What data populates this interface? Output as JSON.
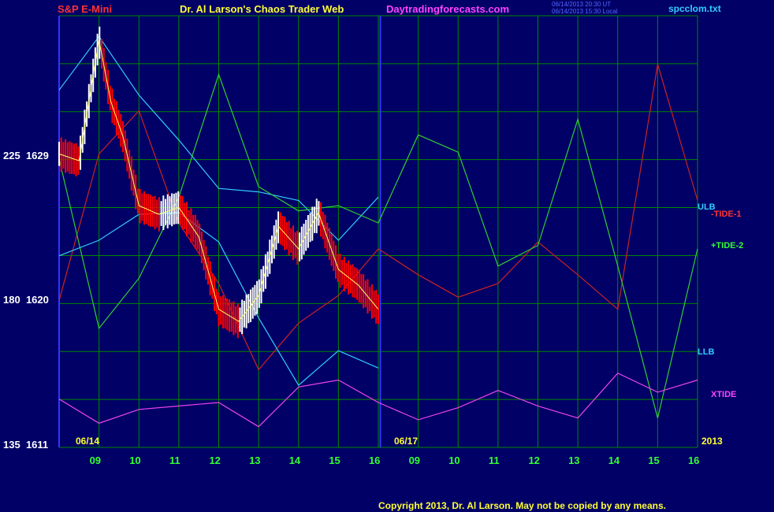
{
  "header": {
    "symbol": "S&P E-Mini",
    "title": "Dr. Al Larson's Chaos Trader Web",
    "site": "Daytradingforecasts.com",
    "timestamp_ut": "06/14/2013 20:30 UT",
    "timestamp_local": "06/14/2013 15:30 Local",
    "file": "spcclom.txt"
  },
  "colors": {
    "background": "#000066",
    "grid": "#008800",
    "price_up": "#ffffff",
    "price_down": "#ff0000",
    "bands": "#33ccff",
    "tide1": "#cc2222",
    "tide2": "#33cc33",
    "xtide": "#ee44ee",
    "divider": "#3333ff"
  },
  "chart_data": {
    "type": "line",
    "title": "S&P E-Mini",
    "y_tick_labels": [
      {
        "left": "225",
        "right": "1629"
      },
      {
        "left": "180",
        "right": "1620"
      },
      {
        "left": "135",
        "right": "1611"
      }
    ],
    "x_tick_labels": [
      "09",
      "10",
      "11",
      "12",
      "13",
      "14",
      "15",
      "16",
      "09",
      "10",
      "11",
      "12",
      "13",
      "14",
      "15",
      "16"
    ],
    "date_labels": [
      "06/14",
      "06/17",
      "2013"
    ],
    "series": [
      {
        "name": "ULB",
        "color": "#33ccff",
        "x": [
          0,
          1,
          2,
          3,
          4,
          5,
          6,
          7,
          8
        ],
        "y": [
          1631.7,
          1634.8,
          1631.4,
          1628.8,
          1626.0,
          1625.8,
          1625.3,
          1623.0,
          1625.5
        ]
      },
      {
        "name": "-TIDE-1",
        "color": "#cc2222",
        "x": [
          0,
          1,
          2,
          3,
          4,
          5,
          6,
          7,
          8,
          9,
          10,
          11,
          12,
          13,
          14,
          15,
          16
        ],
        "y": [
          1619.5,
          1628.0,
          1630.5,
          1624.0,
          1620.5,
          1615.5,
          1618.2,
          1619.8,
          1622.5,
          1621.0,
          1619.7,
          1620.5,
          1622.9,
          1621.0,
          1619.0,
          1633.2,
          1625.3
        ]
      },
      {
        "name": "+TIDE-2",
        "color": "#33cc33",
        "x": [
          0,
          1,
          2,
          3,
          4,
          5,
          6,
          7,
          8,
          9,
          10,
          11,
          12,
          13,
          14,
          15,
          16
        ],
        "y": [
          1627.7,
          1617.9,
          1620.8,
          1625.5,
          1632.6,
          1626.1,
          1624.7,
          1625.0,
          1624.0,
          1629.1,
          1628.1,
          1621.5,
          1622.7,
          1630.0,
          1621.5,
          1612.7,
          1622.5
        ]
      },
      {
        "name": "LLB",
        "color": "#33ccff",
        "x": [
          0,
          1,
          2,
          3,
          4,
          5,
          6,
          7,
          8
        ],
        "y": [
          1622.1,
          1623.0,
          1624.5,
          1624.6,
          1622.9,
          1618.5,
          1614.6,
          1616.6,
          1615.6
        ]
      },
      {
        "name": "XTIDE",
        "color": "#ee44ee",
        "x": [
          0,
          1,
          2,
          3,
          4,
          5,
          6,
          7,
          8,
          9,
          10,
          11,
          12,
          13,
          14,
          15,
          16
        ],
        "y": [
          1613.8,
          1612.4,
          1613.2,
          1613.4,
          1613.6,
          1612.2,
          1614.5,
          1614.9,
          1613.6,
          1612.6,
          1613.3,
          1614.3,
          1613.4,
          1612.7,
          1615.3,
          1614.2,
          1614.9
        ]
      }
    ],
    "price": {
      "x": [
        0,
        0.5,
        1,
        1.3,
        1.6,
        2,
        2.5,
        3,
        3.5,
        4,
        4.5,
        5,
        5.5,
        6,
        6.5,
        7,
        7.5,
        8
      ],
      "y": [
        1628.0,
        1627.6,
        1634.6,
        1631.0,
        1629.0,
        1625.0,
        1624.5,
        1624.9,
        1623.2,
        1619.0,
        1618.3,
        1619.8,
        1623.8,
        1622.5,
        1624.6,
        1621.3,
        1620.4,
        1619.0
      ]
    }
  },
  "series_labels": {
    "ulb": "ULB",
    "tide1": "-TIDE-1",
    "tide2": "+TIDE-2",
    "llb": "LLB",
    "xtide": "XTIDE"
  },
  "copyright": "Copyright 2013, Dr. Al Larson. May not be copied by any means."
}
